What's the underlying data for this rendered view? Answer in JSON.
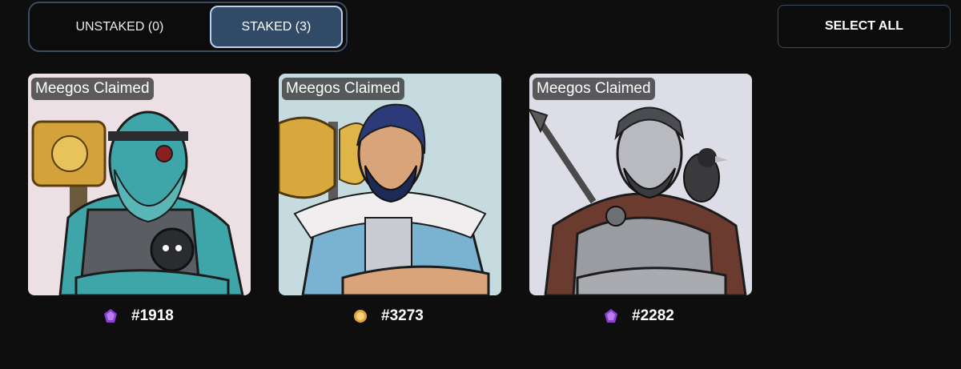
{
  "tabs": [
    {
      "label": "UNSTAKED (0)",
      "active": false
    },
    {
      "label": "STAKED (3)",
      "active": true
    }
  ],
  "actions": {
    "select_all_label": "SELECT ALL"
  },
  "cards": [
    {
      "badge": "Meegos Claimed",
      "id": "#1918",
      "gem": "purple-gem-icon",
      "bg": "#ece0e4",
      "skin": "#3ea6a8",
      "gem_color": "#8a3fd0"
    },
    {
      "badge": "Meegos Claimed",
      "id": "#3273",
      "gem": "gold-gem-icon",
      "bg": "#c6dbe0",
      "skin": "#d9a47a",
      "gem_color": "#e0a43a"
    },
    {
      "badge": "Meegos Claimed",
      "id": "#2282",
      "gem": "purple-gem-icon",
      "bg": "#dcdde6",
      "skin": "#9a9ca2",
      "gem_color": "#8a3fd0"
    }
  ],
  "colors": {
    "accent": "#314a68",
    "accent_border": "#b8d2f0",
    "background": "#0e0e0f"
  }
}
